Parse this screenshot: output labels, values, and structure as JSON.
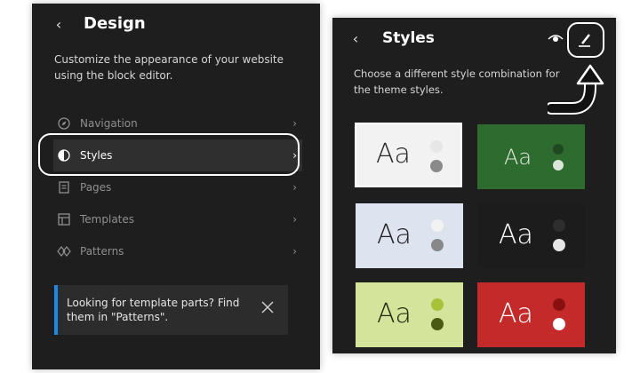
{
  "left_panel": {
    "title": "Design",
    "description": "Customize the appearance of your website using the block editor.",
    "nav": [
      {
        "label": "Navigation",
        "icon": "compass-icon"
      },
      {
        "label": "Styles",
        "icon": "half-circle-icon"
      },
      {
        "label": "Pages",
        "icon": "page-icon"
      },
      {
        "label": "Templates",
        "icon": "layout-icon"
      },
      {
        "label": "Patterns",
        "icon": "diamond-icon"
      }
    ],
    "notice": "Looking for template parts? Find them in \"Patterns\"."
  },
  "right_panel": {
    "title": "Styles",
    "description": "Choose a different style combination for the theme styles.",
    "preview_label": "Aa",
    "styles": [
      {
        "bg": "#f2f2f2",
        "text": "#2a2a2a",
        "dot1": "#e6e6e6",
        "dot2": "#8a8a8a"
      },
      {
        "bg": "#2e6b2e",
        "text": "#dfe9df",
        "dot1": "#1f4a1f",
        "dot2": "#d9e6d9"
      },
      {
        "bg": "#dde4f0",
        "text": "#222222",
        "dot1": "#f2f2f2",
        "dot2": "#888888"
      },
      {
        "bg": "#1c1c1c",
        "text": "#ffffff",
        "dot1": "#2e2e2e",
        "dot2": "#e6e6e6"
      },
      {
        "bg": "#d4e49a",
        "text": "#1f2a0e",
        "dot1": "#a8c23a",
        "dot2": "#4a5a12"
      },
      {
        "bg": "#c42a2a",
        "text": "#ffffff",
        "dot1": "#8a1010",
        "dot2": "#ffffff"
      }
    ]
  },
  "colors": {
    "panel_bg": "#1e1e1e",
    "accent": "#1e88e5"
  }
}
